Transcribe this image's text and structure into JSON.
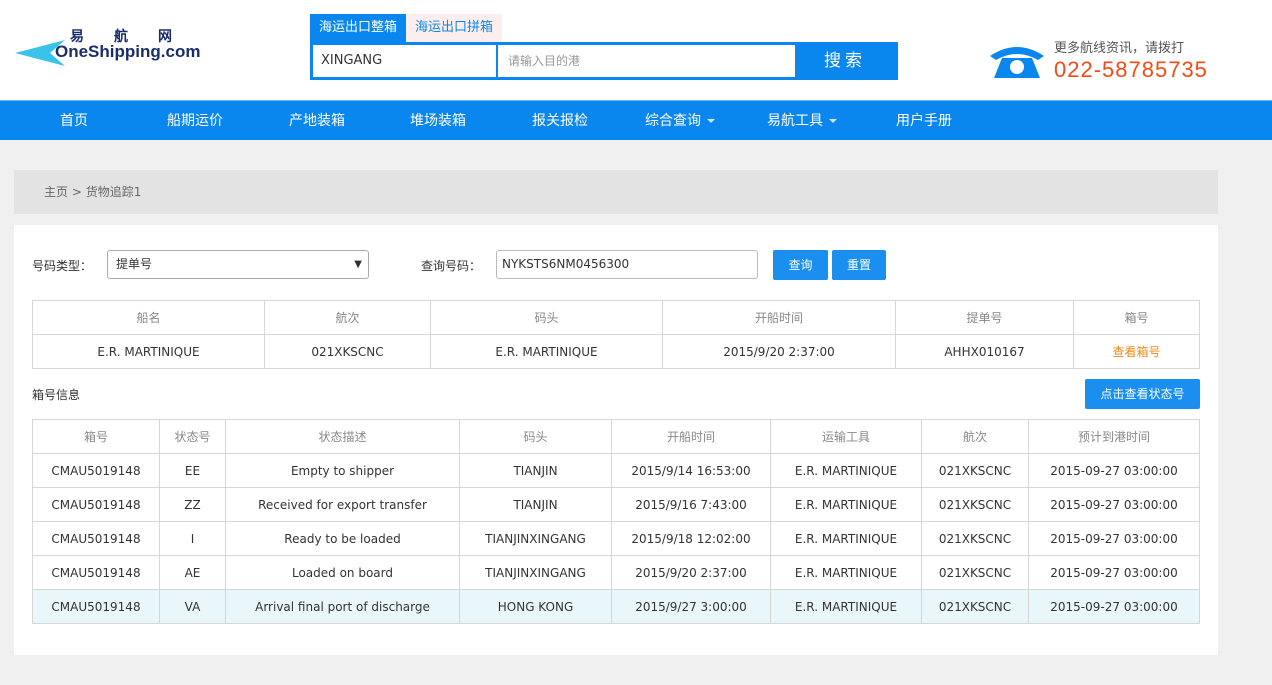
{
  "header": {
    "logo": {
      "cn": "易航网",
      "en": "OneShipping.com"
    },
    "search_tabs": [
      {
        "label": "海运出口整箱",
        "active": true
      },
      {
        "label": "海运出口拼箱",
        "active": false
      }
    ],
    "port_value": "XINGANG",
    "dest_placeholder": "请输入目的港",
    "search_label": "搜索",
    "hotline_text": "更多航线资讯，请拨打",
    "phone": "022-58785735",
    "phone_color": "#f24b14"
  },
  "nav": {
    "items": [
      {
        "label": "首页"
      },
      {
        "label": "船期运价"
      },
      {
        "label": "产地装箱"
      },
      {
        "label": "堆场装箱"
      },
      {
        "label": "报关报检"
      },
      {
        "label": "综合查询",
        "dropdown": true
      },
      {
        "label": "易航工具",
        "dropdown": true
      },
      {
        "label": "用户手册"
      }
    ]
  },
  "breadcrumb": {
    "home": "主页",
    "sep": ">",
    "current": "货物追踪1"
  },
  "form": {
    "type_label": "号码类型：",
    "type_value": "提单号",
    "query_label": "查询号码：",
    "query_value": "NYKSTS6NM0456300",
    "query_btn": "查询",
    "reset_btn": "重置"
  },
  "vessel_table": {
    "headers": [
      "船名",
      "航次",
      "码头",
      "开船时间",
      "提单号",
      "箱号"
    ],
    "row": [
      "E.R. MARTINIQUE",
      "021XKSCNC",
      "E.R. MARTINIQUE",
      "2015/9/20 2:37:00",
      "AHHX010167",
      "查看箱号"
    ]
  },
  "container": {
    "title": "箱号信息",
    "status_btn": "点击查看状态号",
    "headers": [
      "箱号",
      "状态号",
      "状态描述",
      "码头",
      "开船时间",
      "运输工具",
      "航次",
      "预计到港时间"
    ],
    "rows": [
      [
        "CMAU5019148",
        "EE",
        "Empty to shipper",
        "TIANJIN",
        "2015/9/14 16:53:00",
        "E.R. MARTINIQUE",
        "021XKSCNC",
        "2015-09-27 03:00:00"
      ],
      [
        "CMAU5019148",
        "ZZ",
        "Received for export transfer",
        "TIANJIN",
        "2015/9/16 7:43:00",
        "E.R. MARTINIQUE",
        "021XKSCNC",
        "2015-09-27 03:00:00"
      ],
      [
        "CMAU5019148",
        "I",
        "Ready to be loaded",
        "TIANJINXINGANG",
        "2015/9/18 12:02:00",
        "E.R. MARTINIQUE",
        "021XKSCNC",
        "2015-09-27 03:00:00"
      ],
      [
        "CMAU5019148",
        "AE",
        "Loaded on board",
        "TIANJINXINGANG",
        "2015/9/20 2:37:00",
        "E.R. MARTINIQUE",
        "021XKSCNC",
        "2015-09-27 03:00:00"
      ],
      [
        "CMAU5019148",
        "VA",
        "Arrival final port of discharge",
        "HONG KONG",
        "2015/9/27 3:00:00",
        "E.R. MARTINIQUE",
        "021XKSCNC",
        "2015-09-27 03:00:00"
      ]
    ]
  }
}
